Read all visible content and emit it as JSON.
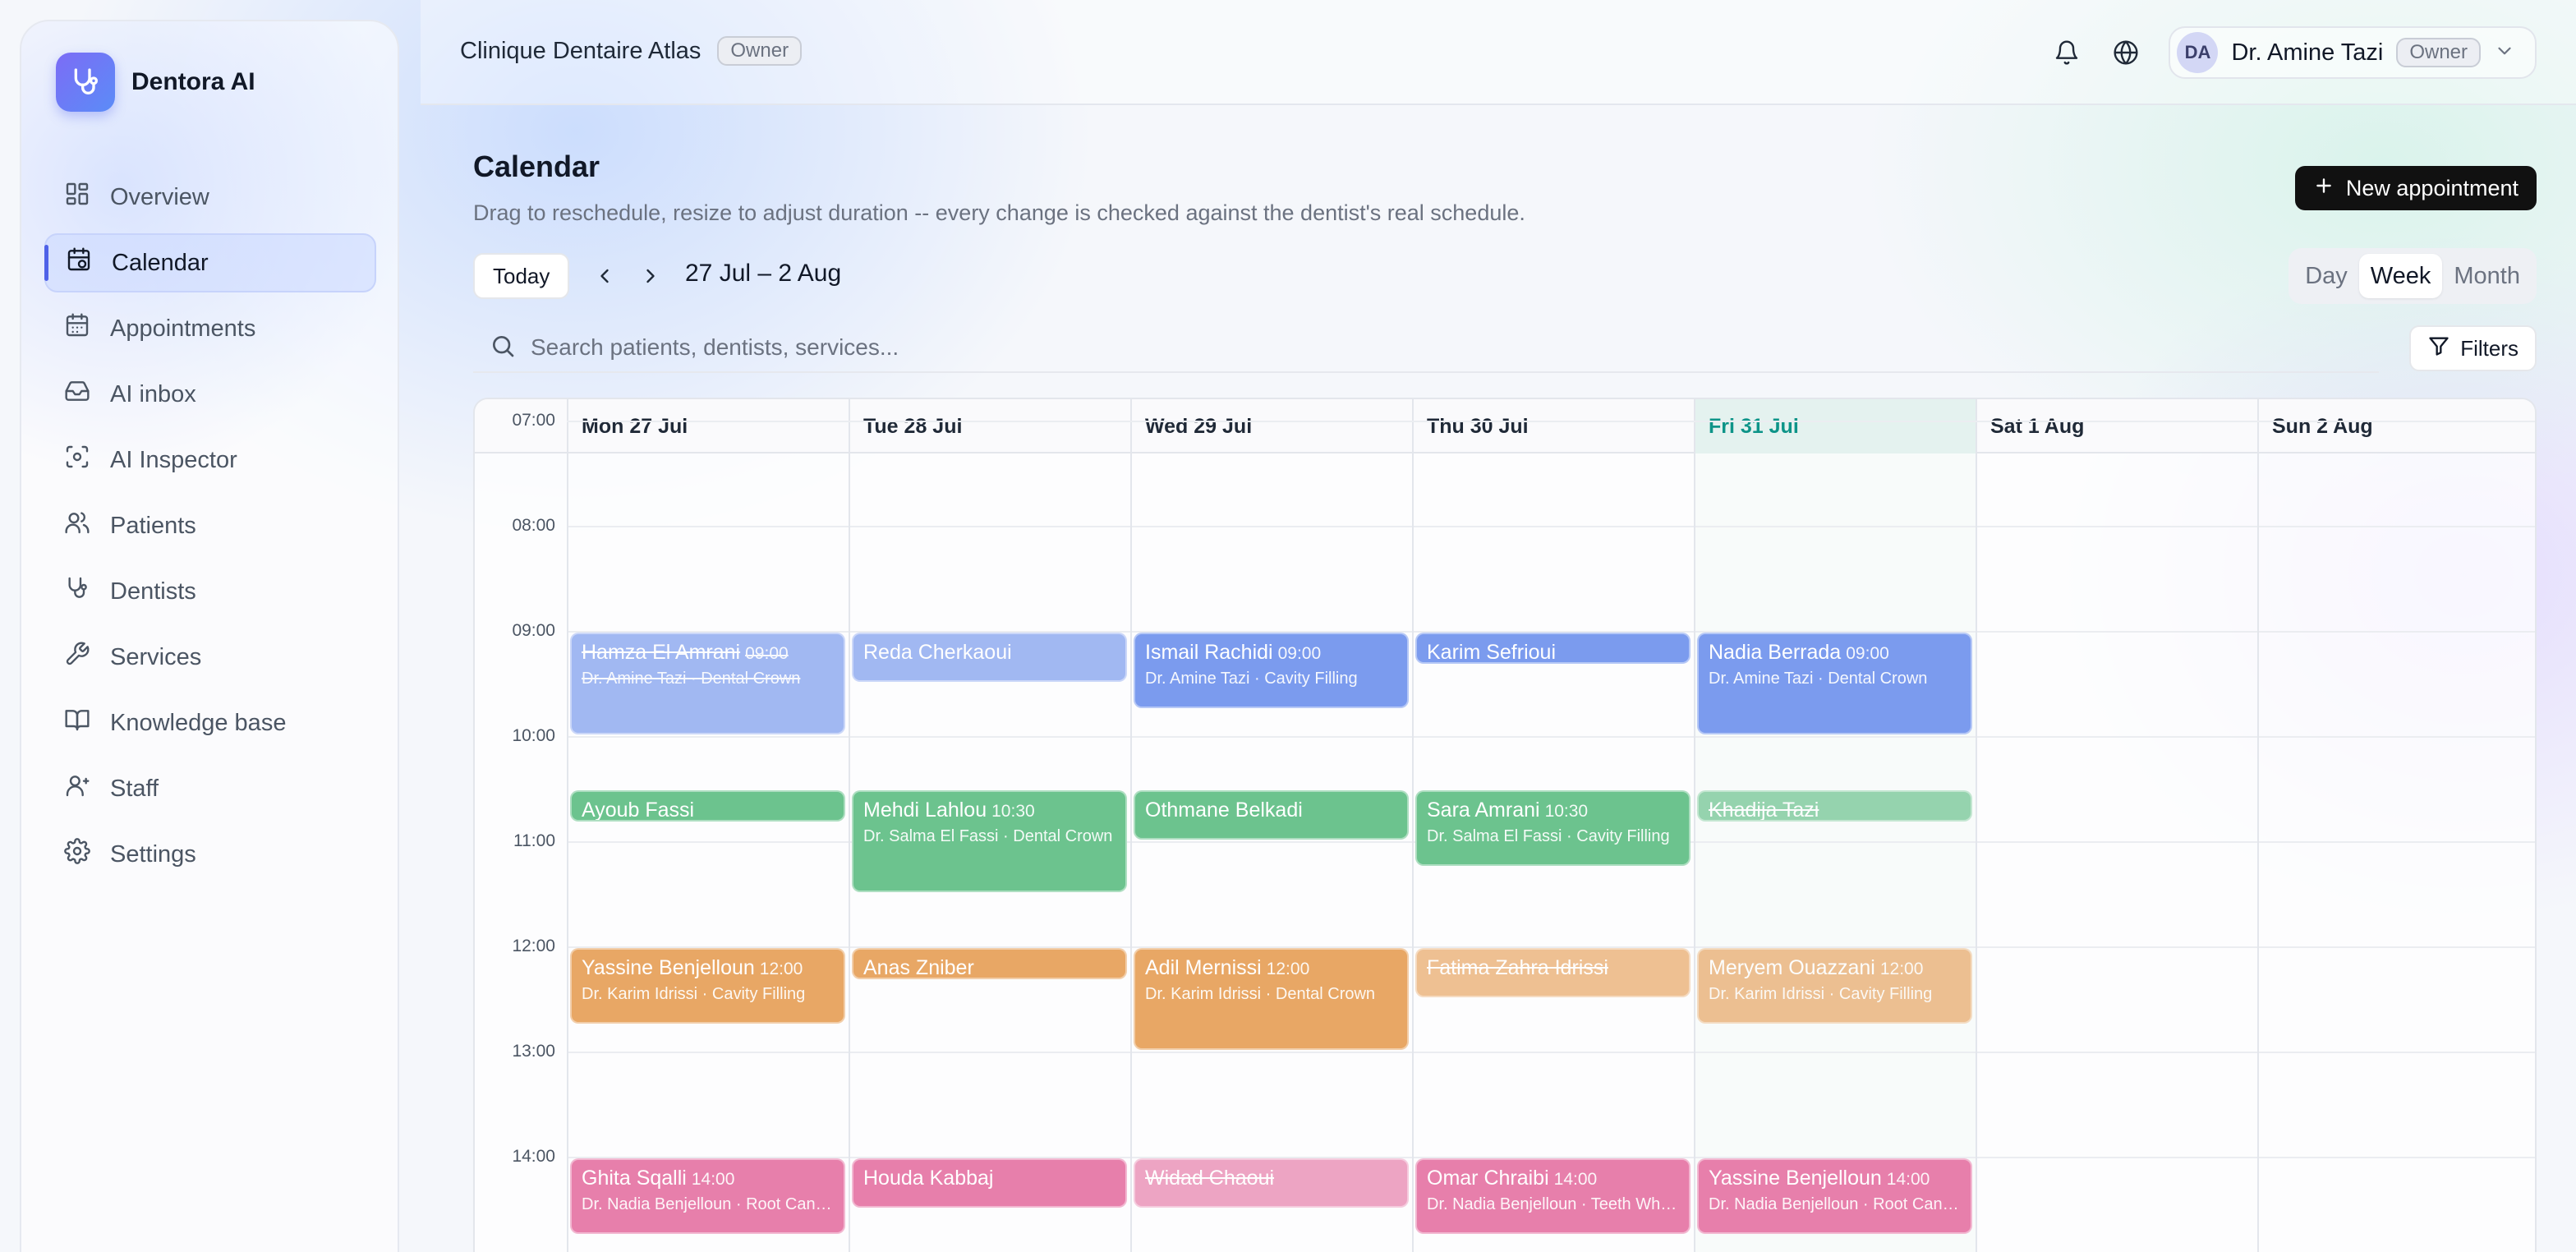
{
  "app": {
    "name": "Dentora AI"
  },
  "sidebar": {
    "items": [
      {
        "label": "Overview",
        "icon": "overview-icon"
      },
      {
        "label": "Calendar",
        "icon": "calendar-icon",
        "active": true
      },
      {
        "label": "Appointments",
        "icon": "appointments-icon"
      },
      {
        "label": "AI inbox",
        "icon": "inbox-icon"
      },
      {
        "label": "AI Inspector",
        "icon": "inspector-icon"
      },
      {
        "label": "Patients",
        "icon": "patients-icon"
      },
      {
        "label": "Dentists",
        "icon": "stethoscope-icon"
      },
      {
        "label": "Services",
        "icon": "wrench-icon"
      },
      {
        "label": "Knowledge base",
        "icon": "book-icon"
      },
      {
        "label": "Staff",
        "icon": "staff-icon"
      },
      {
        "label": "Settings",
        "icon": "gear-icon"
      }
    ]
  },
  "header": {
    "clinic_name": "Clinique Dentaire Atlas",
    "clinic_role": "Owner",
    "user_initials": "DA",
    "user_name": "Dr. Amine Tazi",
    "user_role": "Owner"
  },
  "page": {
    "title": "Calendar",
    "subtitle": "Drag to reschedule, resize to adjust duration -- every change is checked against the dentist's real schedule.",
    "new_button": "New appointment"
  },
  "toolbar": {
    "today": "Today",
    "range": "27 Jul – 2 Aug",
    "views": [
      "Day",
      "Week",
      "Month"
    ],
    "active_view": "Week"
  },
  "search": {
    "placeholder": "Search patients, dentists, services...",
    "filters": "Filters"
  },
  "calendar": {
    "days": [
      "Mon 27 Jul",
      "Tue 28 Jul",
      "Wed 29 Jul",
      "Thu 30 Jul",
      "Fri 31 Jul",
      "Sat 1 Aug",
      "Sun 2 Aug"
    ],
    "today_index": 4,
    "hours": [
      "07:00",
      "08:00",
      "09:00",
      "10:00",
      "11:00",
      "12:00",
      "13:00",
      "14:00"
    ],
    "colors": {
      "blue": "#7b9bee",
      "green": "#6cc38e",
      "orange": "#e8a765",
      "pink": "#e77fab"
    },
    "appointments": [
      {
        "day": 0,
        "start": 9.0,
        "end": 10.0,
        "color": "blue",
        "patient": "Hamza El Amrani",
        "time": "09:00",
        "details": "Dr. Amine Tazi · Dental Crown",
        "cancelled": true
      },
      {
        "day": 1,
        "start": 9.0,
        "end": 9.5,
        "color": "blue",
        "patient": "Reda Cherkaoui",
        "time": "",
        "details": "",
        "faded": true
      },
      {
        "day": 2,
        "start": 9.0,
        "end": 9.75,
        "color": "blue",
        "patient": "Ismail Rachidi",
        "time": "09:00",
        "details": "Dr. Amine Tazi · Cavity Filling"
      },
      {
        "day": 3,
        "start": 9.0,
        "end": 9.33,
        "color": "blue",
        "patient": "Karim Sefrioui",
        "time": "",
        "details": ""
      },
      {
        "day": 4,
        "start": 9.0,
        "end": 10.0,
        "color": "blue",
        "patient": "Nadia Berrada",
        "time": "09:00",
        "details": "Dr. Amine Tazi · Dental Crown"
      },
      {
        "day": 0,
        "start": 10.5,
        "end": 10.83,
        "color": "green",
        "patient": "Ayoub Fassi",
        "time": "",
        "details": ""
      },
      {
        "day": 1,
        "start": 10.5,
        "end": 11.5,
        "color": "green",
        "patient": "Mehdi Lahlou",
        "time": "10:30",
        "details": "Dr. Salma El Fassi · Dental Crown"
      },
      {
        "day": 2,
        "start": 10.5,
        "end": 11.0,
        "color": "green",
        "patient": "Othmane Belkadi",
        "time": "",
        "details": ""
      },
      {
        "day": 3,
        "start": 10.5,
        "end": 11.25,
        "color": "green",
        "patient": "Sara Amrani",
        "time": "10:30",
        "details": "Dr. Salma El Fassi · Cavity Filling"
      },
      {
        "day": 4,
        "start": 10.5,
        "end": 10.83,
        "color": "green",
        "patient": "Khadija Tazi",
        "time": "",
        "details": "",
        "cancelled": true
      },
      {
        "day": 0,
        "start": 12.0,
        "end": 12.75,
        "color": "orange",
        "patient": "Yassine Benjelloun",
        "time": "12:00",
        "details": "Dr. Karim Idrissi · Cavity Filling"
      },
      {
        "day": 1,
        "start": 12.0,
        "end": 12.33,
        "color": "orange",
        "patient": "Anas Zniber",
        "time": "",
        "details": ""
      },
      {
        "day": 2,
        "start": 12.0,
        "end": 13.0,
        "color": "orange",
        "patient": "Adil Mernissi",
        "time": "12:00",
        "details": "Dr. Karim Idrissi · Dental Crown"
      },
      {
        "day": 3,
        "start": 12.0,
        "end": 12.5,
        "color": "orange",
        "patient": "Fatima Zahra Idrissi",
        "time": "",
        "details": "",
        "cancelled": true
      },
      {
        "day": 4,
        "start": 12.0,
        "end": 12.75,
        "color": "orange",
        "patient": "Meryem Ouazzani",
        "time": "12:00",
        "details": "Dr. Karim Idrissi · Cavity Filling",
        "faded": true
      },
      {
        "day": 0,
        "start": 14.0,
        "end": 14.75,
        "color": "pink",
        "patient": "Ghita Sqalli",
        "time": "14:00",
        "details": "Dr. Nadia Benjelloun · Root Cana..."
      },
      {
        "day": 1,
        "start": 14.0,
        "end": 14.5,
        "color": "pink",
        "patient": "Houda Kabbaj",
        "time": "",
        "details": ""
      },
      {
        "day": 2,
        "start": 14.0,
        "end": 14.5,
        "color": "pink",
        "patient": "Widad Chaoui",
        "time": "",
        "details": "",
        "cancelled": true
      },
      {
        "day": 3,
        "start": 14.0,
        "end": 14.75,
        "color": "pink",
        "patient": "Omar Chraibi",
        "time": "14:00",
        "details": "Dr. Nadia Benjelloun · Teeth Whit..."
      },
      {
        "day": 4,
        "start": 14.0,
        "end": 14.75,
        "color": "pink",
        "patient": "Yassine Benjelloun",
        "time": "14:00",
        "details": "Dr. Nadia Benjelloun · Root Cana..."
      }
    ]
  }
}
